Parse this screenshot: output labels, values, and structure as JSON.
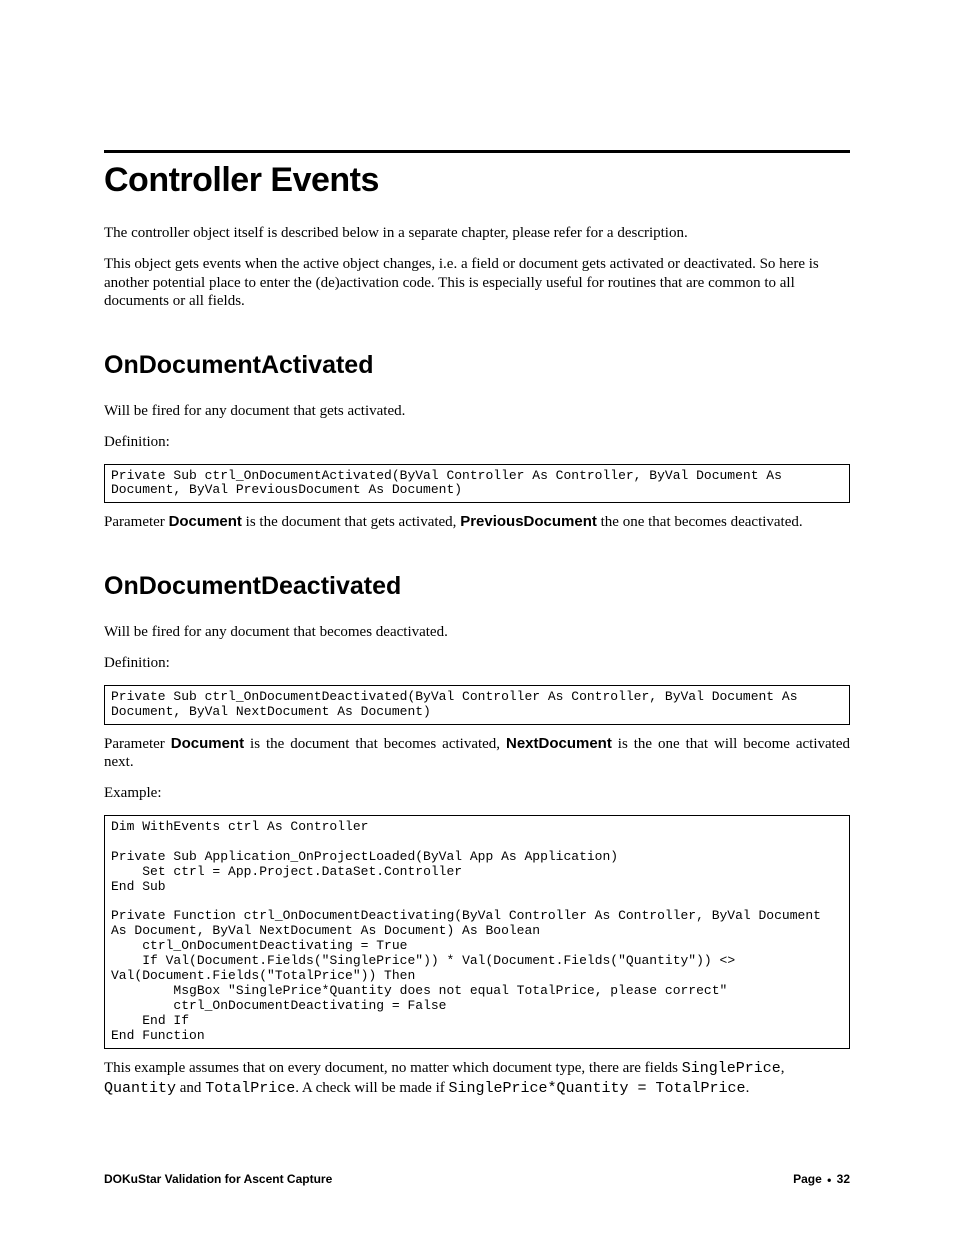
{
  "title": "Controller Events",
  "intro1": "The controller object itself is described below in a separate chapter, please refer for a description.",
  "intro2": "This object gets events when the active object changes, i.e. a field or document gets activated or deactivated. So here is another potential place to enter the (de)activation code. This is especially useful for routines that are common to all documents or all fields.",
  "s1": {
    "heading": "OnDocumentActivated",
    "p1": "Will be fired for any document that gets activated.",
    "deflabel": "Definition:",
    "code": "Private Sub ctrl_OnDocumentActivated(ByVal Controller As Controller, ByVal Document As Document, ByVal PreviousDocument As Document)",
    "param_pre": "Parameter ",
    "param_b1": "Document",
    "param_mid": " is the document that gets activated, ",
    "param_b2": "PreviousDocument",
    "param_post": " the one that becomes deactivated."
  },
  "s2": {
    "heading": "OnDocumentDeactivated",
    "p1": "Will be fired for any document that becomes deactivated.",
    "deflabel": "Definition:",
    "code": "Private Sub ctrl_OnDocumentDeactivated(ByVal Controller As Controller, ByVal Document As Document, ByVal NextDocument As Document)",
    "param_pre": "Parameter ",
    "param_b1": "Document",
    "param_mid": " is the document that becomes activated, ",
    "param_b2": "NextDocument",
    "param_post": " is the one that will become activated next.",
    "examplelabel": "Example:",
    "code2": "Dim WithEvents ctrl As Controller\n\nPrivate Sub Application_OnProjectLoaded(ByVal App As Application)\n    Set ctrl = App.Project.DataSet.Controller\nEnd Sub\n\nPrivate Function ctrl_OnDocumentDeactivating(ByVal Controller As Controller, ByVal Document As Document, ByVal NextDocument As Document) As Boolean\n    ctrl_OnDocumentDeactivating = True\n    If Val(Document.Fields(\"SinglePrice\")) * Val(Document.Fields(\"Quantity\")) <> Val(Document.Fields(\"TotalPrice\")) Then\n        MsgBox \"SinglePrice*Quantity does not equal TotalPrice, please correct\"\n        ctrl_OnDocumentDeactivating = False\n    End If\nEnd Function",
    "explain_t1": "This example assumes that on every document, no matter which document type, there are fields ",
    "explain_c1": "SinglePrice",
    "explain_t2": ", ",
    "explain_c2": "Quantity",
    "explain_t3": " and ",
    "explain_c3": "TotalPrice",
    "explain_t4": ". A check will be made if ",
    "explain_c4": "SinglePrice*Quantity = TotalPrice",
    "explain_t5": "."
  },
  "footer": {
    "left": "DOKuStar Validation for Ascent Capture",
    "page_label": "Page",
    "page_num": "32"
  }
}
